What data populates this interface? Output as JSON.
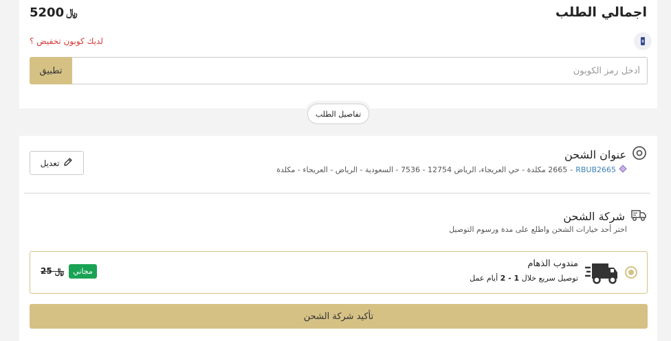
{
  "summary": {
    "total_label": "اجمالي الطلب",
    "total_amount": "5200",
    "currency": "﷼",
    "coupon_question": "لديك كوبون تخفيض ؟",
    "coupon_placeholder": "أدخل رمز الكوبون",
    "apply_label": "تطبيق"
  },
  "details_label": "تفاصيل الطلب",
  "address": {
    "title": "عنوان الشحن",
    "code": "RBUB2665",
    "separator": "-",
    "text": "2665 مكلدة - حي العريجاء، الرياض 12754 - 7536 - السعودية - الرياض - العريجاء - مكلدة",
    "edit_label": "تعديل"
  },
  "shipping": {
    "title": "شركة الشحن",
    "subtitle": "اختر أحد خيارات الشحن واطلع على مدة ورسوم التوصيل",
    "option": {
      "name": "مندوب الذهام",
      "desc_prefix": "توصيل سريع خلال",
      "desc_range": "1 - 2",
      "desc_suffix": "أيام عمل",
      "old_price": "25",
      "badge": "مجاني",
      "selected": true
    },
    "confirm_label": "تأكيد شركة الشحن"
  },
  "colors": {
    "accent": "#d6c185",
    "free_badge": "#1aa354",
    "coupon_question": "#d83a3a",
    "address_code": "#3b82b5"
  },
  "icons": [
    "coupon-icon",
    "location-pin-icon",
    "pencil-icon",
    "shipping-truck-icon",
    "delivery-truck-icon"
  ]
}
